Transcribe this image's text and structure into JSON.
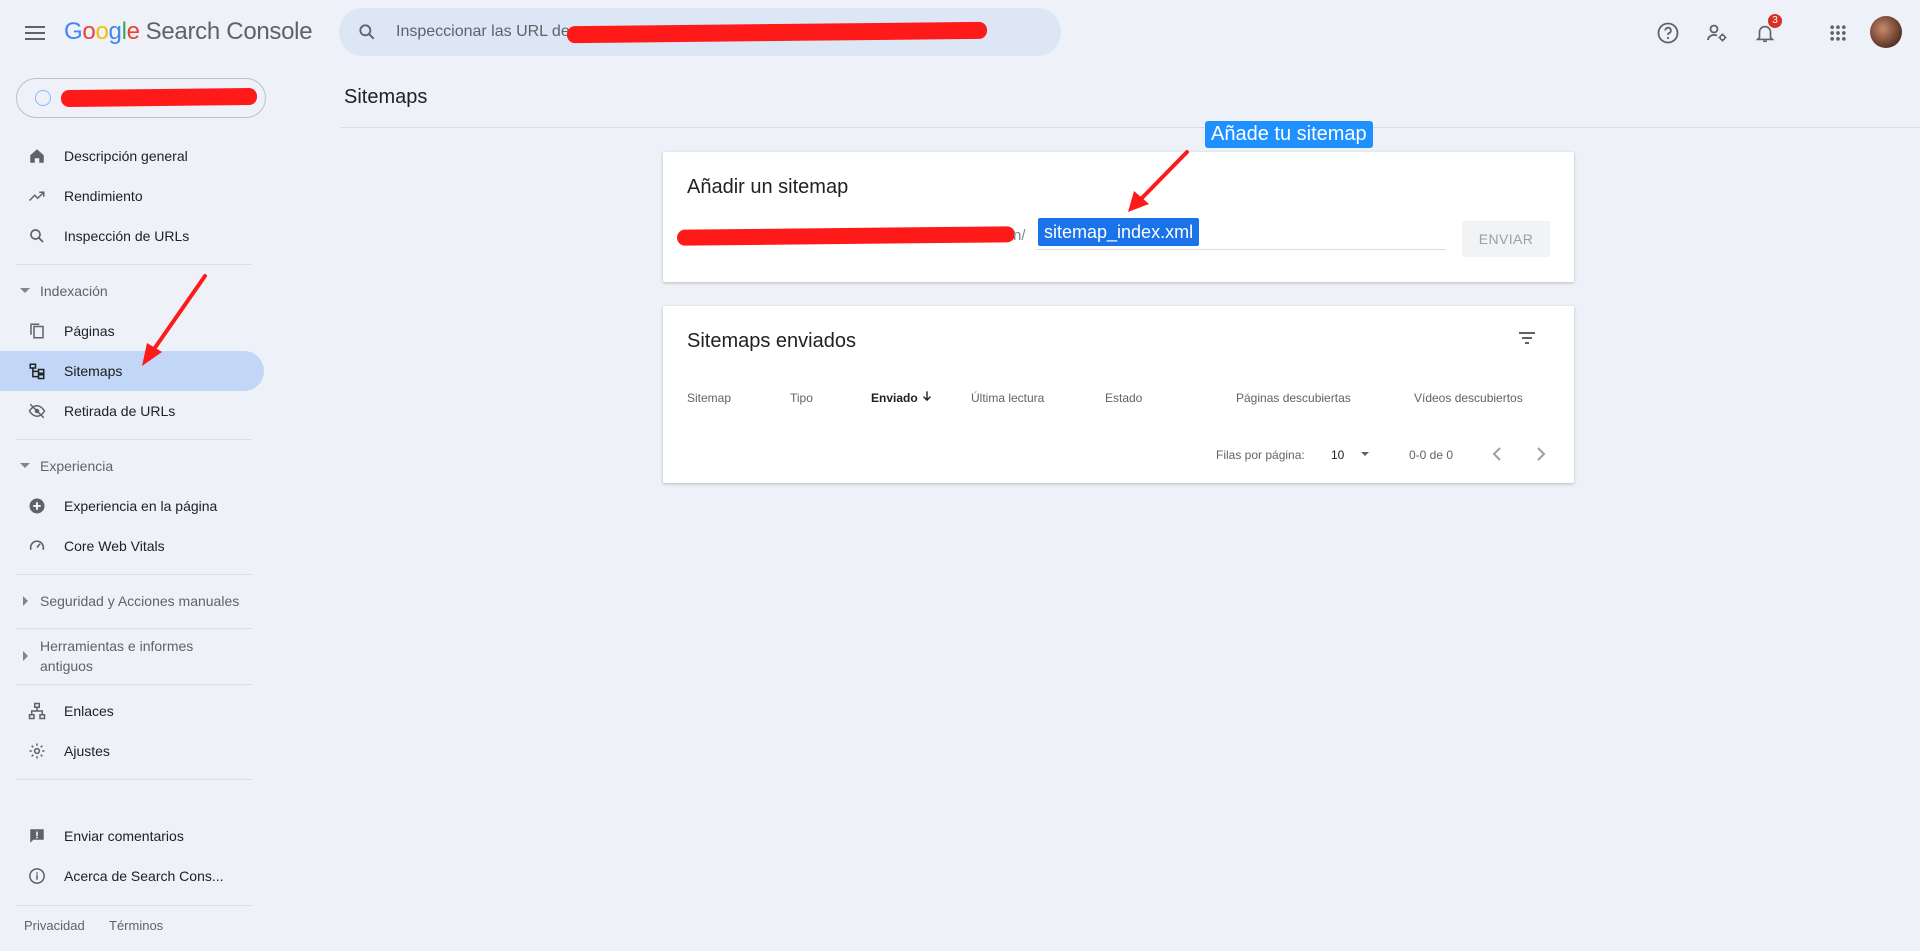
{
  "header": {
    "logo": {
      "g1": "G",
      "g2": "o",
      "g3": "o",
      "g4": "g",
      "g5": "l",
      "g6": "e",
      "product": "Search Console"
    },
    "search_placeholder": "Inspeccionar las URL de",
    "notification_count": "3",
    "icons": [
      "menu-icon",
      "search-icon",
      "help-icon",
      "settings-account-icon",
      "notifications-icon",
      "apps-icon"
    ]
  },
  "sidebar": {
    "nav": [
      {
        "label": "Descripción general",
        "icon": "home-icon"
      },
      {
        "label": "Rendimiento",
        "icon": "trending-up-icon"
      },
      {
        "label": "Inspección de URLs",
        "icon": "search-icon"
      }
    ],
    "indexing": {
      "label": "Indexación",
      "items": [
        {
          "label": "Páginas",
          "icon": "pages-icon"
        },
        {
          "label": "Sitemaps",
          "icon": "sitemap-icon",
          "active": true
        },
        {
          "label": "Retirada de URLs",
          "icon": "eye-off-icon"
        }
      ]
    },
    "experience": {
      "label": "Experiencia",
      "items": [
        {
          "label": "Experiencia en la página",
          "icon": "plus-circle-icon"
        },
        {
          "label": "Core Web Vitals",
          "icon": "gauge-icon"
        }
      ]
    },
    "security_label": "Seguridad y Acciones manuales",
    "legacy_label_line1": "Herramientas e informes",
    "legacy_label_line2": "antiguos",
    "bottom_items": [
      {
        "label": "Enlaces",
        "icon": "links-icon"
      },
      {
        "label": "Ajustes",
        "icon": "gear-icon"
      }
    ],
    "meta_items": [
      {
        "label": "Enviar comentarios",
        "icon": "feedback-icon"
      },
      {
        "label": "Acerca de Search Cons...",
        "icon": "info-icon"
      }
    ],
    "footer": {
      "privacy": "Privacidad",
      "terms": "Términos"
    }
  },
  "main": {
    "page_title": "Sitemaps",
    "add_card": {
      "title": "Añadir un sitemap",
      "url_suffix": "n/",
      "input_value": "sitemap_index.xml",
      "submit_label": "ENVIAR"
    },
    "submitted_card": {
      "title": "Sitemaps enviados",
      "columns": [
        "Sitemap",
        "Tipo",
        "Enviado",
        "Última lectura",
        "Estado",
        "Páginas descubiertas",
        "Vídeos descubiertos"
      ],
      "sorted_column": "Enviado",
      "rows_per_page_label": "Filas por página:",
      "rows_per_page_value": "10",
      "range_label": "0-0 de 0"
    }
  },
  "annotation": {
    "callout": "Añade tu sitemap",
    "color": "#1e90ff",
    "arrow_color": "#ff1a1a",
    "redaction_color": "#ff1a1a"
  }
}
